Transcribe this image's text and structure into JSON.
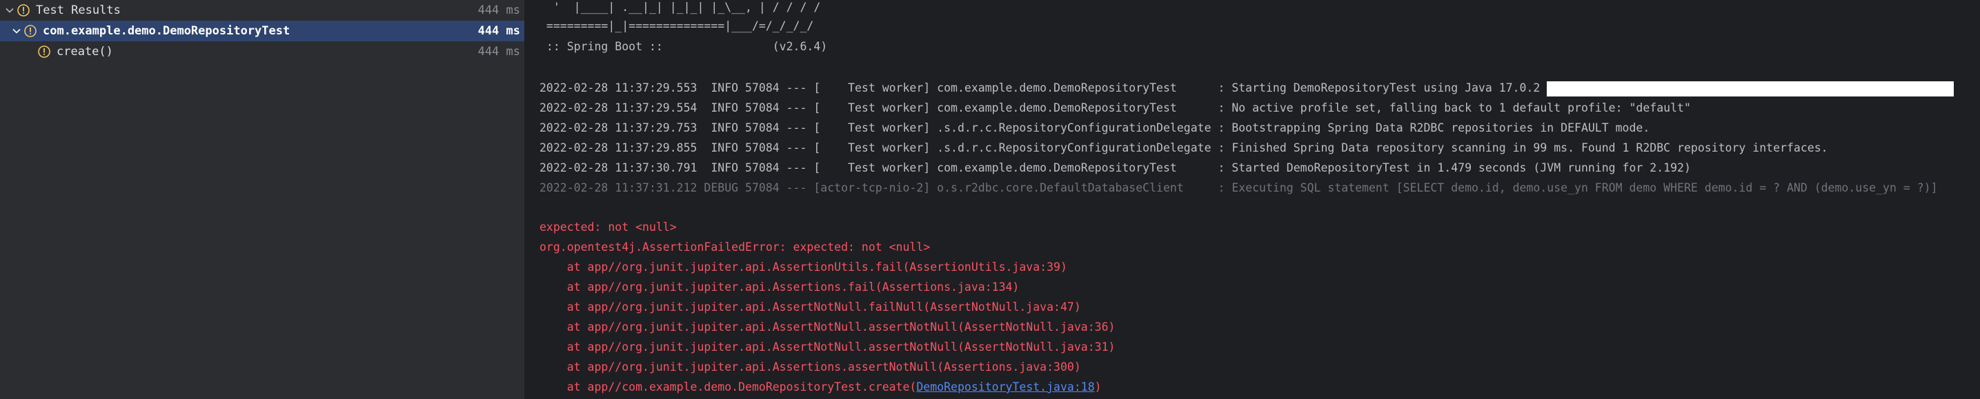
{
  "tree": {
    "rows": [
      {
        "label": "Test Results",
        "time": "444 ms",
        "expanded": true,
        "status": "warning"
      },
      {
        "label": "com.example.demo.DemoRepositoryTest",
        "time": "444 ms",
        "expanded": true,
        "status": "warning",
        "selected": true
      },
      {
        "label": "create()",
        "time": "444 ms",
        "status": "warning"
      }
    ],
    "icons": {
      "expand": "chevron-down-icon",
      "status": "warning-circle-icon"
    }
  },
  "console": {
    "banner": [
      "  '  |____| .__|_| |_|_| |_\\__, | / / / /",
      " =========|_|==============|___/=/_/_/_/",
      " :: Spring Boot ::                (v2.6.4)"
    ],
    "logs": [
      {
        "text": "2022-02-28 11:37:29.553  INFO 57084 --- [    Test worker] com.example.demo.DemoRepositoryTest      : Starting DemoRepositoryTest using Java 17.0.2 ",
        "level": "info",
        "redacted": true
      },
      {
        "text": "2022-02-28 11:37:29.554  INFO 57084 --- [    Test worker] com.example.demo.DemoRepositoryTest      : No active profile set, falling back to 1 default profile: \"default\"",
        "level": "info"
      },
      {
        "text": "2022-02-28 11:37:29.753  INFO 57084 --- [    Test worker] .s.d.r.c.RepositoryConfigurationDelegate : Bootstrapping Spring Data R2DBC repositories in DEFAULT mode.",
        "level": "info"
      },
      {
        "text": "2022-02-28 11:37:29.855  INFO 57084 --- [    Test worker] .s.d.r.c.RepositoryConfigurationDelegate : Finished Spring Data repository scanning in 99 ms. Found 1 R2DBC repository interfaces.",
        "level": "info"
      },
      {
        "text": "2022-02-28 11:37:30.791  INFO 57084 --- [    Test worker] com.example.demo.DemoRepositoryTest      : Started DemoRepositoryTest in 1.479 seconds (JVM running for 2.192)",
        "level": "info"
      },
      {
        "text": "2022-02-28 11:37:31.212 DEBUG 57084 --- [actor-tcp-nio-2] o.s.r2dbc.core.DefaultDatabaseClient     : Executing SQL statement [SELECT demo.id, demo.use_yn FROM demo WHERE demo.id = ? AND (demo.use_yn = ?)]",
        "level": "debug"
      }
    ],
    "errors": [
      "expected: not <null>",
      "org.opentest4j.AssertionFailedError: expected: not <null>",
      "    at app//org.junit.jupiter.api.AssertionUtils.fail(AssertionUtils.java:39)",
      "    at app//org.junit.jupiter.api.Assertions.fail(Assertions.java:134)",
      "    at app//org.junit.jupiter.api.AssertNotNull.failNull(AssertNotNull.java:47)",
      "    at app//org.junit.jupiter.api.AssertNotNull.assertNotNull(AssertNotNull.java:36)",
      "    at app//org.junit.jupiter.api.AssertNotNull.assertNotNull(AssertNotNull.java:31)",
      "    at app//org.junit.jupiter.api.Assertions.assertNotNull(Assertions.java:300)"
    ],
    "last_frame": {
      "prefix": "    at app//com.example.demo.DemoRepositoryTest.create(",
      "link": "DemoRepositoryTest.java:18",
      "suffix": ")"
    }
  },
  "colors": {
    "tree_bg": "#2b2d30",
    "console_bg": "#1e1f22",
    "selection": "#2e436e",
    "warning": "#f2c55c",
    "error_text": "#f75464",
    "debug_text": "#6f737a",
    "link": "#548af7"
  }
}
